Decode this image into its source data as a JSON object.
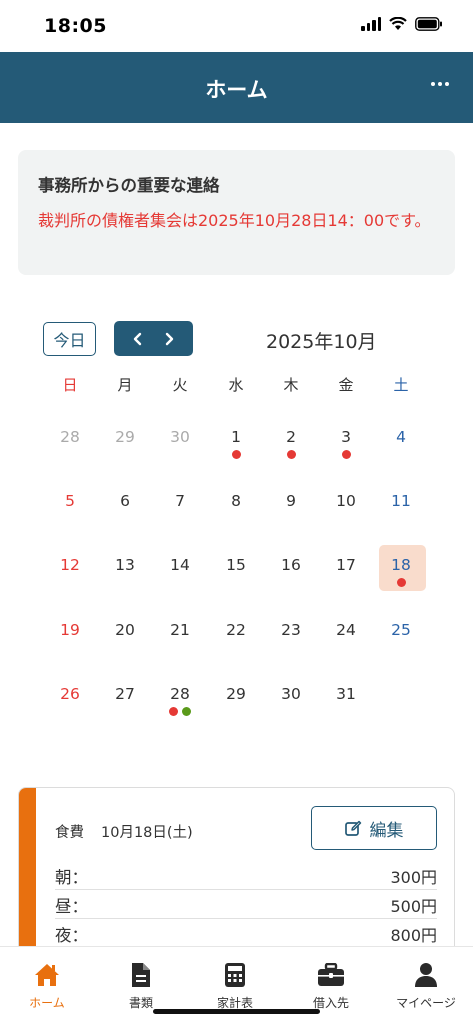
{
  "status_bar": {
    "time": "18:05"
  },
  "header": {
    "title": "ホーム"
  },
  "notice": {
    "title": "事務所からの重要な連絡",
    "message": "裁判所の債権者集会は2025年10月28日14：00です。",
    "color": "#e53935"
  },
  "calendar": {
    "today_button": "今日",
    "month_label": "2025年10月",
    "weekdays": [
      "日",
      "月",
      "火",
      "水",
      "木",
      "金",
      "土"
    ],
    "weeks": [
      [
        {
          "d": "28",
          "other": true
        },
        {
          "d": "29",
          "other": true
        },
        {
          "d": "30",
          "other": true
        },
        {
          "d": "1",
          "dots": [
            "red"
          ]
        },
        {
          "d": "2",
          "dots": [
            "red"
          ]
        },
        {
          "d": "3",
          "dots": [
            "red"
          ]
        },
        {
          "d": "4"
        }
      ],
      [
        {
          "d": "5"
        },
        {
          "d": "6"
        },
        {
          "d": "7"
        },
        {
          "d": "8"
        },
        {
          "d": "9"
        },
        {
          "d": "10"
        },
        {
          "d": "11"
        }
      ],
      [
        {
          "d": "12"
        },
        {
          "d": "13"
        },
        {
          "d": "14"
        },
        {
          "d": "15"
        },
        {
          "d": "16"
        },
        {
          "d": "17"
        },
        {
          "d": "18",
          "dots": [
            "red"
          ],
          "selected": true
        }
      ],
      [
        {
          "d": "19"
        },
        {
          "d": "20"
        },
        {
          "d": "21"
        },
        {
          "d": "22"
        },
        {
          "d": "23"
        },
        {
          "d": "24"
        },
        {
          "d": "25"
        }
      ],
      [
        {
          "d": "26"
        },
        {
          "d": "27"
        },
        {
          "d": "28",
          "dots": [
            "red",
            "green"
          ]
        },
        {
          "d": "29"
        },
        {
          "d": "30"
        },
        {
          "d": "31"
        }
      ]
    ],
    "colors": {
      "red": "#e53935",
      "green": "#5a9a1a",
      "sunday": "#e53935",
      "saturday": "#2b63a8",
      "selected_bg": "#f9dccc"
    }
  },
  "expense": {
    "category": "食費",
    "date": "10月18日(土)",
    "edit_label": "編集",
    "meals": [
      {
        "label": "朝：",
        "amount": "300円"
      },
      {
        "label": "昼：",
        "amount": "500円"
      },
      {
        "label": "夜：",
        "amount": "800円"
      }
    ],
    "accent_color": "#e8700f"
  },
  "bottom_nav": {
    "items": [
      {
        "label": "ホーム",
        "icon": "home-icon",
        "active": true
      },
      {
        "label": "書類",
        "icon": "document-icon"
      },
      {
        "label": "家計表",
        "icon": "calculator-icon"
      },
      {
        "label": "借入先",
        "icon": "briefcase-icon"
      },
      {
        "label": "マイページ",
        "icon": "person-icon"
      }
    ]
  }
}
